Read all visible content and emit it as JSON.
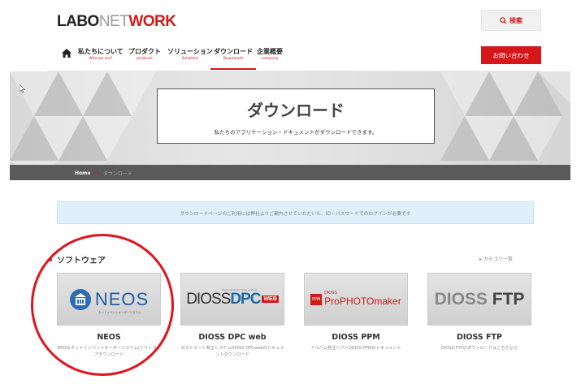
{
  "header": {
    "logo_part1": "LABO",
    "logo_part2": "NET",
    "logo_part3": "WORK",
    "search_label": "検索"
  },
  "nav": {
    "items": [
      {
        "label": "私たちについて",
        "sub": "Who we are?"
      },
      {
        "label": "プロダクト",
        "sub": "products"
      },
      {
        "label": "ソリューション",
        "sub": "Solutions"
      },
      {
        "label": "ダウンロード",
        "sub": "Downloads"
      },
      {
        "label": "企業概要",
        "sub": "company"
      }
    ],
    "contact_label": "お問い合わせ"
  },
  "hero": {
    "title": "ダウンロード",
    "subtitle": "私たちのアプリケーション・ドキュメントがダウンロードできます。"
  },
  "breadcrumb": {
    "home": "Home",
    "separator": "»»",
    "current": "ダウンロード"
  },
  "notice": {
    "text": "ダウンロードページのご利用には弊社よりご案内させていただいた、ID・パスワードでのログインが必要です"
  },
  "software": {
    "title": "ソフトウェア",
    "category_link": "▸ カテゴリ一覧",
    "products": [
      {
        "name": "NEOS",
        "desc": "NEOS(ネットインベントオーダーシステム)ソフトウェアダウンロード",
        "logo_text": "NEOS",
        "logo_sub": "ネットイベントオーダーシステム"
      },
      {
        "name": "DIOSS DPC web",
        "desc": "ポストカード発注システムDIOSS DPCwebのドキュメントダウンロード",
        "logo_d1": "DIOSS",
        "logo_d2": "DPC",
        "logo_badge": "WEB",
        "logo_tag": "Photo postcard order system"
      },
      {
        "name": "DIOSS PPM",
        "desc": "アルバム発注ソフトDIOSS PPMのドキュメント",
        "logo_dioss": "DIOSS",
        "logo_text": "ProPHOTOmaker",
        "logo_icon": "PPM"
      },
      {
        "name": "DIOSS FTP",
        "desc": "DIOSS FTPのダウンロードはこちらから",
        "logo_d": "DIOSS",
        "logo_f": "FTP"
      }
    ]
  },
  "colors": {
    "accent": "#d11919",
    "annotation": "#e1141c",
    "notice_bg": "#dff0fa"
  }
}
